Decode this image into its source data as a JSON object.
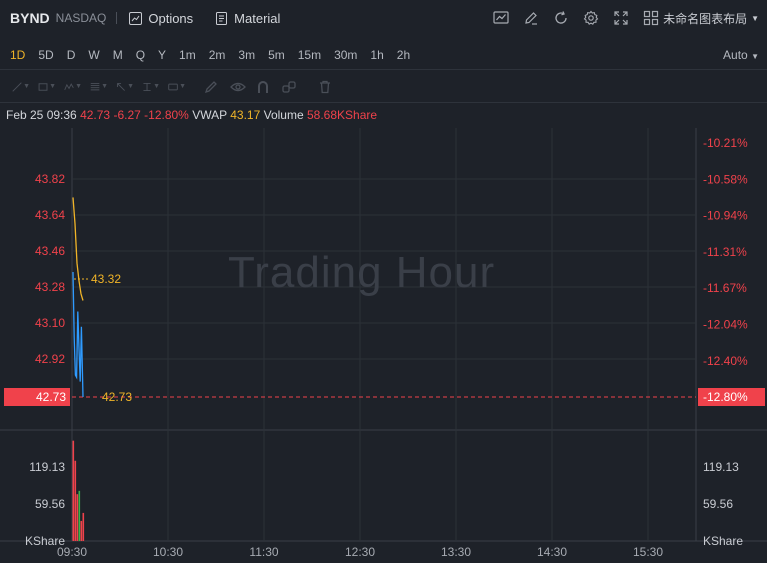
{
  "header": {
    "symbol": "BYND",
    "exchange": "NASDAQ",
    "options_label": "Options",
    "material_label": "Material",
    "layout_name": "未命名图表布局"
  },
  "periods": {
    "items": [
      "1D",
      "5D",
      "D",
      "W",
      "M",
      "Q",
      "Y",
      "1m",
      "2m",
      "3m",
      "5m",
      "15m",
      "30m",
      "1h",
      "2h"
    ],
    "active": "1D",
    "auto_label": "Auto"
  },
  "info": {
    "datetime": "Feb 25 09:36",
    "price": "42.73",
    "change": "-6.27",
    "change_pct": "-12.80%",
    "vwap_label": "VWAP",
    "vwap": "43.17",
    "volume_label": "Volume",
    "volume": "58.68KShare"
  },
  "watermark": "Trading Hour",
  "colors": {
    "background": "#1e2229",
    "grid": "#2c3138",
    "down": "#f0424b",
    "up": "#39b54a",
    "price_line": "#2f9bff",
    "vwap_line": "#f0b428"
  },
  "chart_data": {
    "type": "line",
    "price_ticks": [
      "43.82",
      "43.64",
      "43.46",
      "43.28",
      "43.10",
      "42.92"
    ],
    "pct_ticks": [
      "-10.21%",
      "-10.58%",
      "-10.94%",
      "-11.31%",
      "-11.67%",
      "-12.04%",
      "-12.40%"
    ],
    "current_price": "42.73",
    "current_pct": "-12.80%",
    "avg_price_label": "43.32",
    "last_price_label": "42.73",
    "volume_ticks": [
      "119.13",
      "59.56"
    ],
    "volume_unit": "KShare",
    "time_ticks": [
      "09:30",
      "10:30",
      "11:30",
      "12:30",
      "13:30",
      "14:30",
      "15:30"
    ],
    "ylim": [
      42.73,
      43.92
    ],
    "volume_ylim": [
      0,
      160
    ],
    "series": [
      {
        "points": [
          [
            0,
            43.3
          ],
          [
            0.6,
            43.0
          ],
          [
            1.2,
            42.83
          ],
          [
            1.8,
            42.82
          ],
          [
            2.4,
            43.12
          ],
          [
            3.0,
            42.95
          ],
          [
            3.6,
            42.8
          ],
          [
            4.2,
            43.05
          ],
          [
            5.0,
            42.73
          ]
        ]
      },
      {
        "points": [
          [
            0,
            43.64
          ],
          [
            1,
            43.52
          ],
          [
            2,
            43.34
          ],
          [
            3,
            43.26
          ],
          [
            4,
            43.2
          ],
          [
            5,
            43.17
          ]
        ]
      }
    ],
    "volume": [
      {
        "t": 0,
        "v": 150,
        "dir": "down"
      },
      {
        "t": 1,
        "v": 120,
        "dir": "down"
      },
      {
        "t": 2,
        "v": 70,
        "dir": "down"
      },
      {
        "t": 3,
        "v": 75,
        "dir": "up"
      },
      {
        "t": 4,
        "v": 30,
        "dir": "down"
      },
      {
        "t": 5,
        "v": 42,
        "dir": "down"
      }
    ]
  }
}
